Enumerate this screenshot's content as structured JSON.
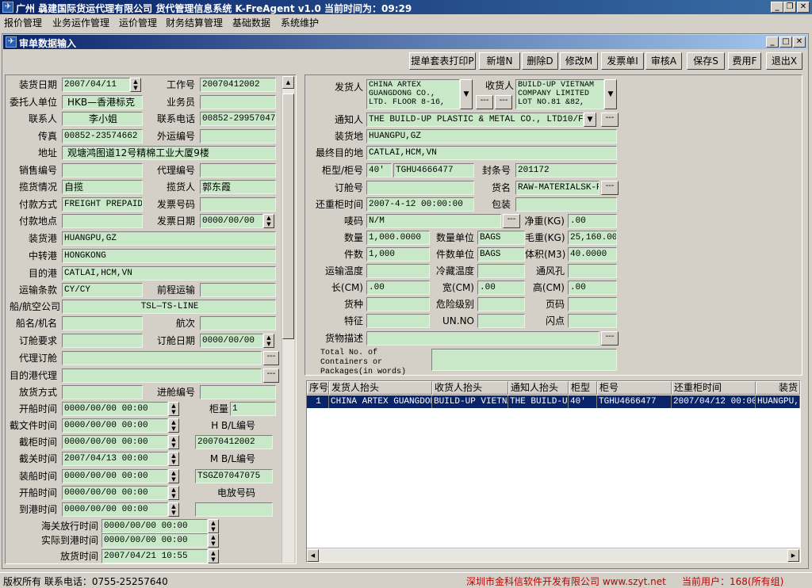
{
  "window": {
    "title": "广州 骉建国际货运代理有限公司  货代管理信息系统  K-FreAgent v1.0   当前时间为：09:29"
  },
  "menu": [
    "报价管理",
    "业务运作管理",
    "运价管理",
    "财务结算管理",
    "基础数据",
    "系统维护"
  ],
  "subwindow": {
    "title": "审单数据输入"
  },
  "toolbar": [
    "提单套表打印P",
    "新增N",
    "删除D",
    "修改M",
    "发票单I",
    "审核A",
    "保存S",
    "费用F",
    "退出X"
  ],
  "left": {
    "ship_date_lbl": "装货日期",
    "ship_date": "2007/04/11",
    "job_no_lbl": "工作号",
    "job_no": "20070412002",
    "consignor_lbl": "委托人单位",
    "consignor": "HKB—香港标克",
    "salesman_lbl": "业务员",
    "salesman": "",
    "contact_lbl": "联系人",
    "contact": "李小姐",
    "phone_lbl": "联系电话",
    "phone": "00852-29957047",
    "fax_lbl": "传真",
    "fax": "00852-23574662",
    "ext_no_lbl": "外运编号",
    "ext_no": "",
    "address_lbl": "地址",
    "address": "观塘鸿图道12号精棉工业大厦9楼",
    "sales_no_lbl": "销售编号",
    "sales_no": "",
    "agent_no_lbl": "代理编号",
    "agent_no": "",
    "pickup_lbl": "揽货情况",
    "pickup": "自揽",
    "pickup_person_lbl": "揽货人",
    "pickup_person": "郭东霞",
    "payment_lbl": "付款方式",
    "payment": "FREIGHT PREPAID",
    "invoice_no_lbl": "发票号码",
    "invoice_no": "",
    "pay_place_lbl": "付款地点",
    "pay_place": "",
    "invoice_date_lbl": "发票日期",
    "invoice_date": "0000/00/00",
    "pol_lbl": "装货港",
    "pol": "HUANGPU,GZ",
    "transit_lbl": "中转港",
    "transit": "HONGKONG",
    "pod_lbl": "目的港",
    "pod": "CATLAI,HCM,VN",
    "terms_lbl": "运输条款",
    "terms": "CY/CY",
    "pre_lbl": "前程运输",
    "pre": "",
    "carrier_lbl": "船/航空公司",
    "carrier": "TSL—TS-LINE",
    "vessel_lbl": "船名/机名",
    "vessel": "",
    "voyage_lbl": "航次",
    "voyage": "",
    "booking_req_lbl": "订舱要求",
    "booking_req": "",
    "booking_date_lbl": "订舱日期",
    "booking_date": "0000/00/00",
    "booking_agent_lbl": "代理订舱",
    "booking_agent": "",
    "dest_agent_lbl": "目的港代理",
    "dest_agent": "",
    "release_lbl": "放货方式",
    "release": "",
    "import_no_lbl": "进舱编号",
    "import_no": "",
    "sail_time_lbl": "开船时间",
    "sail_time": "0000/00/00 00:00",
    "container_qty_lbl": "柜量",
    "container_qty": "1",
    "doc_cut_lbl": "截文件时间",
    "doc_cut": "0000/00/00 00:00",
    "hbl_lbl": "H B/L编号",
    "hbl": "",
    "cy_cut_lbl": "截柜时间",
    "cy_cut": "0000/00/00 00:00",
    "hbl_val": "20070412002",
    "customs_cut_lbl": "截关时间",
    "customs_cut": "2007/04/13  00:00",
    "mbl_lbl": "M B/L编号",
    "mbl": "",
    "load_time_lbl": "装船时间",
    "load_time": "0000/00/00 00:00",
    "mbl_val": "TSGZ07047075",
    "sail2_lbl": "开船时间",
    "sail2": "0000/00/00 00:00",
    "telex_lbl": "电放号码",
    "telex": "",
    "arrive_lbl": "到港时间",
    "arrive": "0000/00/00 00:00",
    "telex_val": "",
    "cust_release_lbl": "海关放行时间",
    "cust_release": "0000/00/00 00:00",
    "actual_arrive_lbl": "实际到港时间",
    "actual_arrive": "0000/00/00 00:00",
    "release_time_lbl": "放货时间",
    "release_time": "2007/04/21 10:55"
  },
  "right": {
    "shipper_lbl": "发货人",
    "shipper": "CHINA ARTEX GUANGDONG CO., LTD. FLOOR 8-16,",
    "consignee_lbl": "收货人",
    "consignee": "BUILD-UP VIETNAM COMPANY LIMITED LOT NO.81 &82,",
    "notify_lbl": "通知人",
    "notify": "THE BUILD-UP PLASTIC & METAL CO., LTD10/F., GE",
    "load_place_lbl": "装货地",
    "load_place": "HUANGPU,GZ",
    "final_dest_lbl": "最终目的地",
    "final_dest": "CATLAI,HCM,VN",
    "ctype_lbl": "柜型/柜号",
    "ctype": "40'",
    "cno": "TGHU4666477",
    "seal_lbl": "封条号",
    "seal": "201172",
    "booking_no_lbl": "订舱号",
    "booking_no": "",
    "goods_name_lbl": "货名",
    "goods_name": "RAW-MATERIALSK-RES",
    "return_time_lbl": "还重柜时间",
    "return_time": "2007-4-12 00:00:00",
    "package_lbl": "包装",
    "package": "",
    "marks_lbl": "唛码",
    "marks": "N/M",
    "net_lbl": "净重(KG)",
    "net": ".00",
    "qty_lbl": "数量",
    "qty": "1,000.0000",
    "qty_unit_lbl": "数量单位",
    "qty_unit": "BAGS",
    "gross_lbl": "毛重(KG)",
    "gross": "25,160.00",
    "pcs_lbl": "件数",
    "pcs": "1,000",
    "pcs_unit_lbl": "件数单位",
    "pcs_unit": "BAGS",
    "vol_lbl": "体积(M3)",
    "vol": "40.0000",
    "temp_lbl": "运输温度",
    "temp": "",
    "cold_lbl": "冷藏温度",
    "cold": "",
    "vent_lbl": "通风孔",
    "vent": "",
    "len_lbl": "长(CM)",
    "len": ".00",
    "wid_lbl": "宽(CM)",
    "wid": ".00",
    "hgt_lbl": "高(CM)",
    "hgt": ".00",
    "kind_lbl": "货种",
    "kind": "",
    "danger_lbl": "危险级别",
    "danger": "",
    "page_lbl": "页码",
    "page": "",
    "feature_lbl": "特征",
    "feature": "",
    "un_lbl": "UN.NO",
    "un": "",
    "flash_lbl": "闪点",
    "flash": "",
    "desc_lbl": "货物描述",
    "desc": "",
    "total_lbl": "Total No. of Containers or Packages(in words)",
    "total": ""
  },
  "grid": {
    "headers": [
      "序号",
      "发货人抬头",
      "收货人抬头",
      "通知人抬头",
      "柜型",
      "柜号",
      "还重柜时间",
      "装货"
    ],
    "row": [
      "1",
      "CHINA ARTEX GUANGDONG",
      "BUILD-UP VIETNAM",
      "THE BUILD-UP",
      "40'",
      "TGHU4666477",
      "2007/04/12 00:00",
      "HUANGPU,G"
    ]
  },
  "status": {
    "copyright": "版权所有  联系电话：0755-25257640",
    "company": "深圳市金科信软件开发有限公司  www.szyt.net",
    "user": "当前用户：168(所有组)"
  },
  "colors": {
    "title": "#0a246a",
    "field": "#c8e8c8",
    "face": "#d4d0c8",
    "status_red": "#c00000"
  }
}
